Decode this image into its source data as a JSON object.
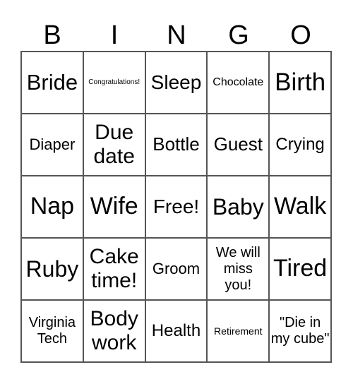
{
  "header": [
    "B",
    "I",
    "N",
    "G",
    "O"
  ],
  "cells": [
    "Bride",
    "Congratulations!",
    "Sleep",
    "Chocolate",
    "Birth",
    "Diaper",
    "Due date",
    "Bottle",
    "Guest",
    "Crying",
    "Nap",
    "Wife",
    "Free!",
    "Baby",
    "Walk",
    "Ruby",
    "Cake time!",
    "Groom",
    "We will miss you!",
    "Tired",
    "Virginia Tech",
    "Body work",
    "Health",
    "Retirement",
    "\"Die in my cube\""
  ]
}
